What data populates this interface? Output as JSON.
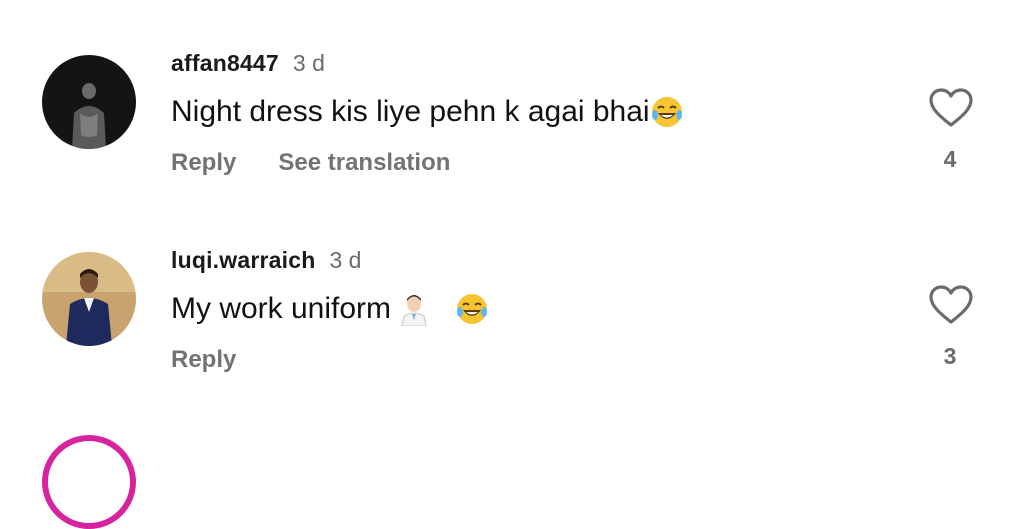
{
  "comments": [
    {
      "username": "affan8447",
      "time": "3 d",
      "text": "Night dress kis liye pehn k agai bhai",
      "emoji": [
        "face-with-tears-of-joy"
      ],
      "actions": {
        "reply": "Reply",
        "translate": "See translation"
      },
      "likes": "4"
    },
    {
      "username": "luqi.warraich",
      "time": "3 d",
      "text": "My work uniform ",
      "emoji": [
        "man-health-worker",
        "face-with-tears-of-joy"
      ],
      "actions": {
        "reply": "Reply"
      },
      "likes": "3"
    }
  ],
  "colors": {
    "text": "#111111",
    "secondary": "#737373",
    "story_ring": "#d6249f"
  }
}
